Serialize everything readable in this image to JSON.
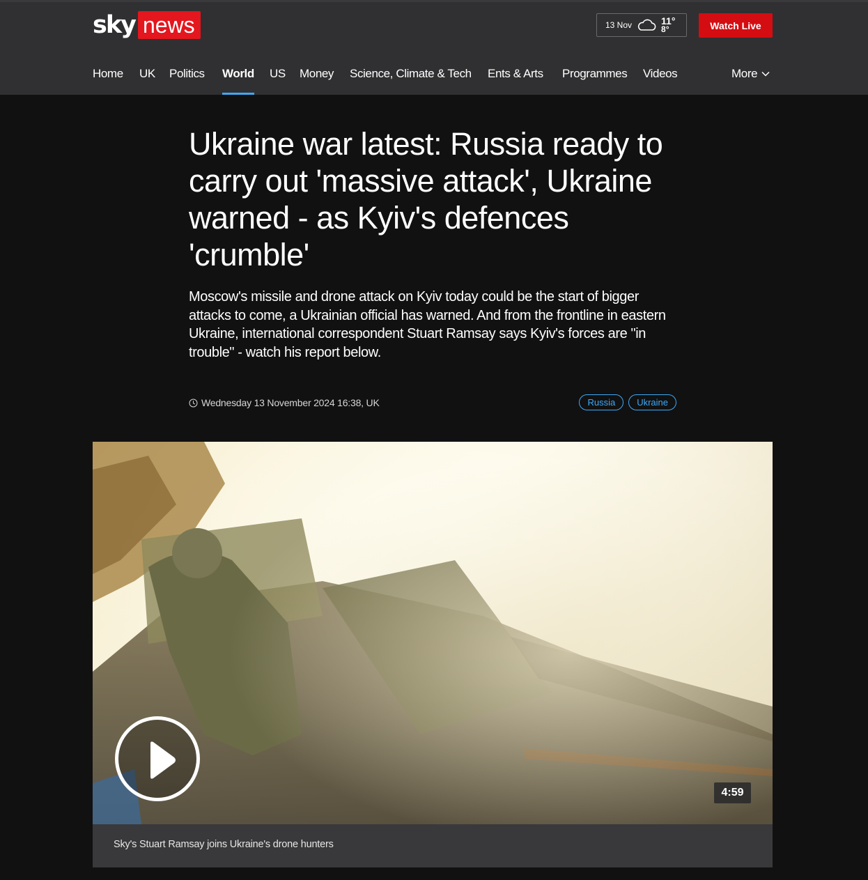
{
  "logo": {
    "sky": "sky",
    "news": "news"
  },
  "weather": {
    "date": "13 Nov",
    "icon": "cloud-icon",
    "high": "11°",
    "low": "8°"
  },
  "watch_live_label": "Watch Live",
  "nav": {
    "items": [
      {
        "label": "Home",
        "active": false
      },
      {
        "label": "UK",
        "active": false
      },
      {
        "label": "Politics",
        "active": false
      },
      {
        "label": "World",
        "active": true
      },
      {
        "label": "US",
        "active": false
      },
      {
        "label": "Money",
        "active": false
      },
      {
        "label": "Science, Climate & Tech",
        "active": false
      },
      {
        "label": "Ents & Arts",
        "active": false
      },
      {
        "label": "Programmes",
        "active": false
      },
      {
        "label": "Videos",
        "active": false
      }
    ],
    "more_label": "More"
  },
  "article": {
    "headline": "Ukraine war latest: Russia ready to carry out 'massive attack', Ukraine warned - as Kyiv's defences 'crumble'",
    "standfirst": "Moscow's missile and drone attack on Kyiv today could be the start of bigger attacks to come, a Ukrainian official has warned. And from the frontline in eastern Ukraine, international correspondent Stuart Ramsay says Kyiv's forces are \"in trouble\" - watch his report below.",
    "timestamp": "Wednesday 13 November 2024 16:38, UK",
    "tags": [
      "Russia",
      "Ukraine"
    ]
  },
  "video": {
    "duration": "4:59",
    "caption": "Sky's Stuart Ramsay joins Ukraine's drone hunters"
  },
  "colors": {
    "header_bg": "#303032",
    "page_bg": "#111112",
    "accent_blue": "#3fa9f5",
    "brand_red": "#e4161e",
    "watch_live_red": "#d40d12"
  }
}
